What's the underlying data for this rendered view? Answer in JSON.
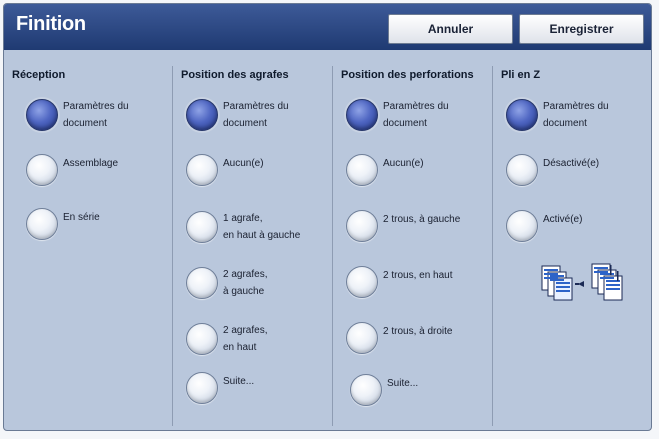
{
  "header": {
    "title": "Finition",
    "cancel_label": "Annuler",
    "save_label": "Enregistrer"
  },
  "columns": [
    {
      "title": "Réception",
      "options": [
        {
          "label_line1": "Paramètres du",
          "label_line2": "document",
          "selected": true
        },
        {
          "label_line1": "Assemblage",
          "label_line2": "",
          "selected": false
        },
        {
          "label_line1": "En série",
          "label_line2": "",
          "selected": false
        }
      ]
    },
    {
      "title": "Position des agrafes",
      "options": [
        {
          "label_line1": "Paramètres du",
          "label_line2": "document",
          "selected": true
        },
        {
          "label_line1": "Aucun(e)",
          "label_line2": "",
          "selected": false
        },
        {
          "label_line1": "1 agrafe,",
          "label_line2": "en haut à gauche",
          "selected": false
        },
        {
          "label_line1": "2 agrafes,",
          "label_line2": "à gauche",
          "selected": false
        },
        {
          "label_line1": "2 agrafes,",
          "label_line2": "en haut",
          "selected": false
        },
        {
          "label_line1": "Suite...",
          "label_line2": "",
          "selected": false
        }
      ]
    },
    {
      "title": "Position des perforations",
      "options": [
        {
          "label_line1": "Paramètres du",
          "label_line2": "document",
          "selected": true
        },
        {
          "label_line1": "Aucun(e)",
          "label_line2": "",
          "selected": false
        },
        {
          "label_line1": "2 trous, à gauche",
          "label_line2": "",
          "selected": false
        },
        {
          "label_line1": "2 trous, en haut",
          "label_line2": "",
          "selected": false
        },
        {
          "label_line1": "2 trous, à droite",
          "label_line2": "",
          "selected": false
        },
        {
          "label_line1": "Suite...",
          "label_line2": "",
          "selected": false
        }
      ]
    },
    {
      "title": "Pli en Z",
      "options": [
        {
          "label_line1": "Paramètres du",
          "label_line2": "document",
          "selected": true
        },
        {
          "label_line1": "Désactivé(e)",
          "label_line2": "",
          "selected": false
        },
        {
          "label_line1": "Activé(e)",
          "label_line2": "",
          "selected": false
        }
      ]
    }
  ],
  "icons": {
    "zfold": "z-fold-pages-icon"
  },
  "colors": {
    "title_bar": "#1f3a72",
    "panel": "#b9c7dc",
    "radio_selected": "#3f57b0"
  }
}
